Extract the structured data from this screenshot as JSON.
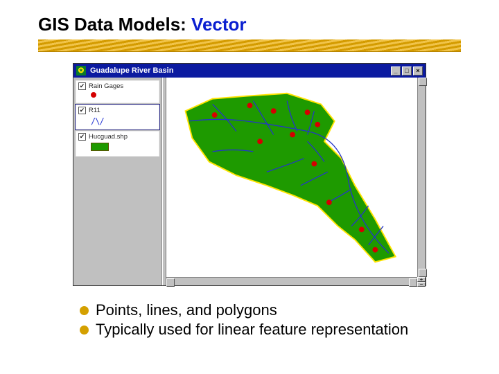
{
  "title": {
    "prefix": "GIS Data Models:  ",
    "accent": "Vector"
  },
  "window": {
    "title": "Guadalupe River Basin",
    "buttons": {
      "min": "_",
      "max": "□",
      "close": "×"
    }
  },
  "layers": [
    {
      "name": "Rain Gages",
      "checked": "✔",
      "symbol": "point"
    },
    {
      "name": "R11",
      "checked": "✔",
      "symbol": "line",
      "line_glyph": "/\\/"
    },
    {
      "name": "Hucguad.shp",
      "checked": "✔",
      "symbol": "polygon"
    }
  ],
  "zoom": {
    "in": "+",
    "out": "−"
  },
  "bullets": [
    "Points, lines, and polygons",
    "Typically used for linear feature representation"
  ],
  "colors": {
    "basin_fill": "#1e9a00",
    "basin_stroke": "#ffe400",
    "river": "#2435c8",
    "gauge": "#d40000",
    "title_accent": "#0a1fd0",
    "bullet": "#d4a000"
  }
}
